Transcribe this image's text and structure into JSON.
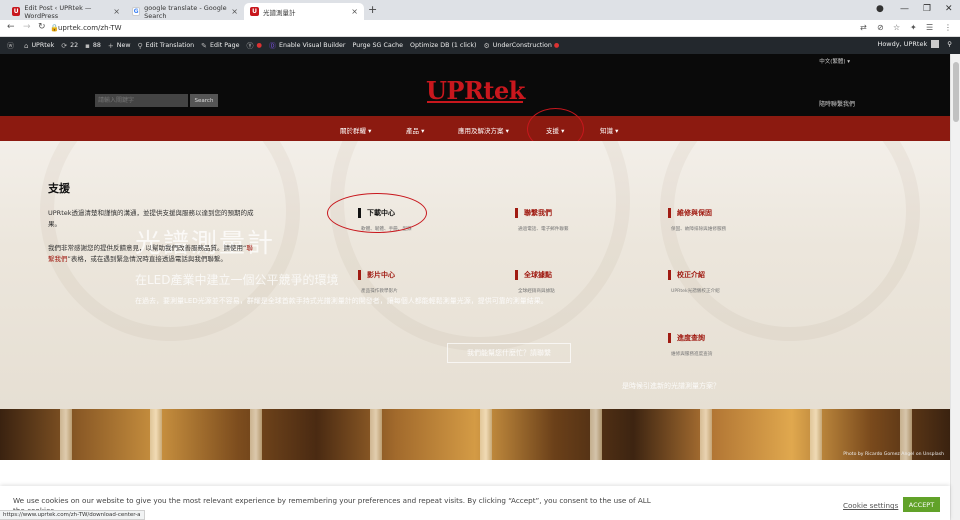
{
  "browser": {
    "tabs": [
      {
        "title": "Edit Post ‹ UPRtek — WordPress",
        "favicon": "U",
        "favicon_color": "#c8171d"
      },
      {
        "title": "google translate - Google Search",
        "favicon": "G",
        "favicon_color": "#4285f4"
      },
      {
        "title": "光譜測量計",
        "favicon": "U",
        "favicon_color": "#c8171d"
      }
    ],
    "new_tab": "+",
    "url": "uprtek.com/zh-TW",
    "status_url": "https://www.uprtek.com/zh-TW/download-center-a"
  },
  "wp_admin": {
    "site_name": "UPRtek",
    "updates_count": "22",
    "comments_count": "88",
    "new_label": "New",
    "edit_translation": "Edit Translation",
    "edit_page": "Edit Page",
    "visual_builder": "Enable Visual Builder",
    "purge_cache": "Purge SG Cache",
    "optimize_db": "Optimize DB (1 click)",
    "under_construction": "UnderConstruction",
    "howdy": "Howdy, UPRtek"
  },
  "site": {
    "language": "中文(繁體) ▾",
    "search_placeholder": "請輸入關鍵字",
    "search_button": "Search",
    "logo": "UPRtek",
    "contact_top": "隨時聯繫我們",
    "nav": [
      {
        "label": "關於群耀 ▾"
      },
      {
        "label": "產品 ▾"
      },
      {
        "label": "應用及解決方案 ▾"
      },
      {
        "label": "支援 ▾"
      },
      {
        "label": "知識 ▾"
      }
    ]
  },
  "support": {
    "title": "支援",
    "p1": "UPRtek透過清楚和謹慎的溝通，並提供支援與服務以達到您的預期的成果。",
    "p2_a": "我們非常感謝您的提供反饋意見，以幫助我們改善服務品質。請使用“",
    "p2_link": "聯繫我們",
    "p2_b": "”表格，或在遇到緊急情況時直接透過電話與我們聯繫。",
    "cards": [
      {
        "title": "下載中心",
        "desc": "軟體、韌體、手冊、型錄"
      },
      {
        "title": "聯繫我們",
        "desc": "通過電話、電子郵件聯繫"
      },
      {
        "title": "維修與保固",
        "desc": "保固、故障排除與維修服務"
      },
      {
        "title": "影片中心",
        "desc": "產品操作教學影片"
      },
      {
        "title": "全球據點",
        "desc": "全球經銷商與據點"
      },
      {
        "title": "校正介紹",
        "desc": "UPRtek光譜儀校正介紹"
      },
      {
        "title": "進度查詢",
        "desc": "維修與服務進度查詢"
      }
    ]
  },
  "hero_ghost": {
    "h1": "光譜測量計",
    "h2": "在LED產業中建立一個公平競爭的環境",
    "p": "在過去，要測量LED光源並不容易，群耀是全球首款手持式光譜測量計的開發者，讓每個人都能輕鬆測量光源，提供可靠的測量結果。",
    "button": "我們能幫您什麼忙？請聯繫",
    "tagline": "是時候引進新的光譜測量方案？"
  },
  "photo": {
    "credit": "Photo by Ricardo Gomez Angel on Unsplash"
  },
  "cookie": {
    "text": "We use cookies on our website to give you the most relevant experience by remembering your preferences and repeat visits. By clicking “Accept”, you consent to the use of ALL the cookies.",
    "settings": "Cookie settings",
    "accept": "ACCEPT"
  },
  "colors": {
    "brand_red": "#c8171d",
    "nav_red": "#8c1a10",
    "wp_bar": "#23282d",
    "accept_green": "#61a229"
  }
}
